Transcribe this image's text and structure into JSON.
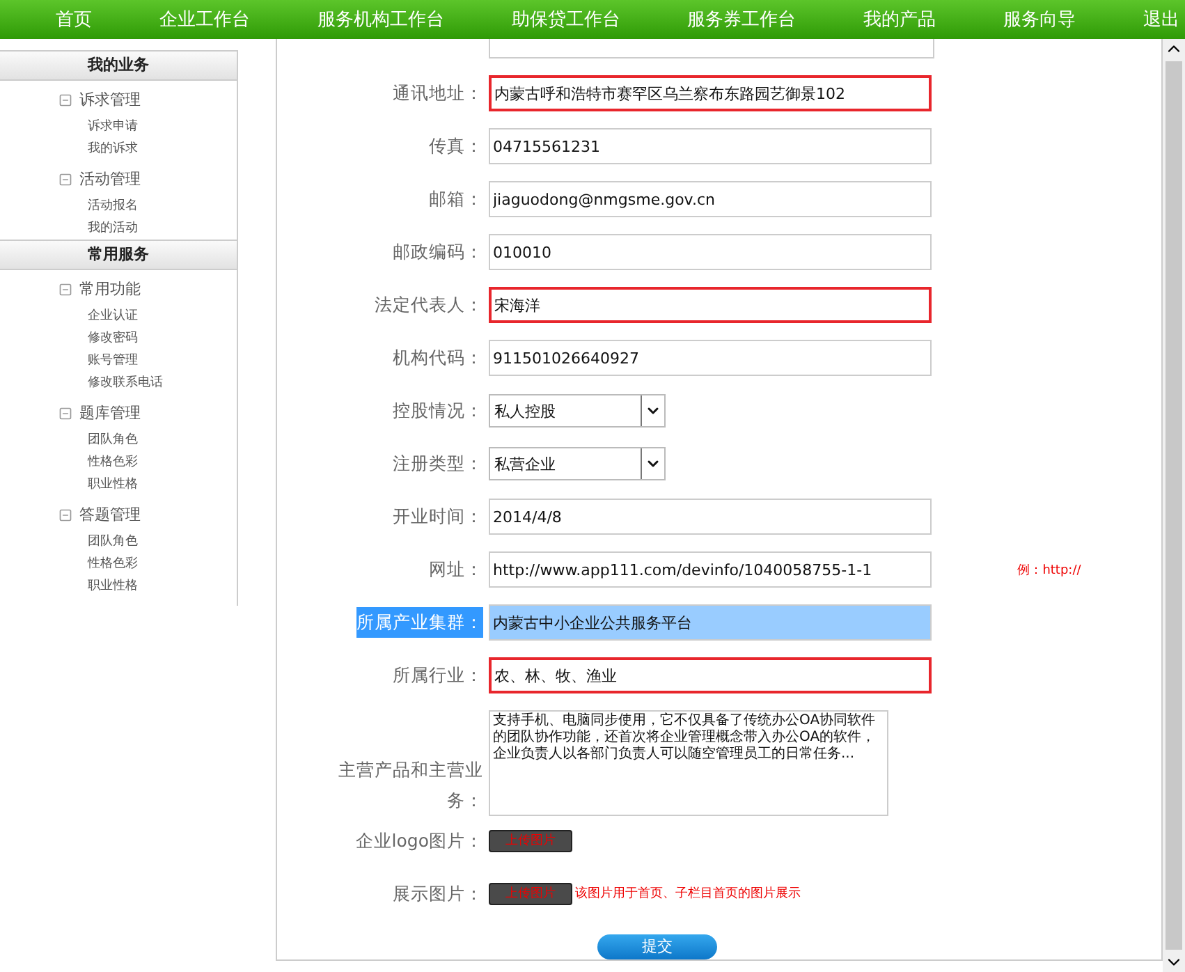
{
  "nav": {
    "items": [
      "首页",
      "企业工作台",
      "服务机构工作台",
      "助保贷工作台",
      "服务券工作台",
      "我的产品",
      "服务向导",
      "退出"
    ]
  },
  "sidebar": {
    "sections": [
      {
        "title": "我的业务",
        "groups": [
          {
            "title": "诉求管理",
            "expanded": true,
            "items": [
              "诉求申请",
              "我的诉求"
            ]
          },
          {
            "title": "活动管理",
            "expanded": true,
            "items": [
              "活动报名",
              "我的活动"
            ]
          }
        ]
      },
      {
        "title": "常用服务",
        "groups": [
          {
            "title": "常用功能",
            "expanded": true,
            "items": [
              "企业认证",
              "修改密码",
              "账号管理",
              "修改联系电话"
            ]
          },
          {
            "title": "题库管理",
            "expanded": true,
            "items": [
              "团队角色",
              "性格色彩",
              "职业性格"
            ]
          },
          {
            "title": "答题管理",
            "expanded": true,
            "items": [
              "团队角色",
              "性格色彩",
              "职业性格"
            ]
          }
        ]
      }
    ]
  },
  "form": {
    "rows": [
      {
        "kind": "text",
        "label": "通讯地址：",
        "value": "内蒙古呼和浩特市赛罕区乌兰察布东路园艺御景102",
        "highlighted": true
      },
      {
        "kind": "text",
        "label": "传真：",
        "value": "04715561231",
        "highlighted": false
      },
      {
        "kind": "text",
        "label": "邮箱：",
        "value": "jiaguodong@nmgsme.gov.cn",
        "highlighted": false
      },
      {
        "kind": "text",
        "label": "邮政编码：",
        "value": "010010",
        "highlighted": false
      },
      {
        "kind": "text",
        "label": "法定代表人：",
        "value": "宋海洋",
        "highlighted": true
      },
      {
        "kind": "text",
        "label": "机构代码：",
        "value": "911501026640927",
        "highlighted": false
      },
      {
        "kind": "select",
        "label": "控股情况：",
        "value": "私人控股"
      },
      {
        "kind": "select",
        "label": "注册类型：",
        "value": "私营企业"
      },
      {
        "kind": "text",
        "label": "开业时间：",
        "value": "2014/4/8",
        "highlighted": false
      },
      {
        "kind": "text",
        "label": "网址：",
        "value": "http://www.app111.com/devinfo/1040058755-1-1",
        "highlighted": false,
        "hint": "例：http://"
      },
      {
        "kind": "text",
        "label": "所属产业集群：",
        "value": "内蒙古中小企业公共服务平台",
        "highlighted": false,
        "text_selected": true
      },
      {
        "kind": "text",
        "label": "所属行业：",
        "value": "农、林、牧、渔业",
        "highlighted": true
      },
      {
        "kind": "textarea",
        "label": "主营产品和主营业务：",
        "value": "支持手机、电脑同步使用，它不仅具备了传统办公OA协同软件的团队协作功能，还首次将企业管理概念带入办公OA的软件，企业负责人以各部门负责人可以随空管理员工的日常任务..."
      },
      {
        "kind": "upload",
        "label": "企业logo图片：",
        "button": "上传图片"
      },
      {
        "kind": "upload",
        "label": "展示图片：",
        "button": "上传图片",
        "hint": "该图片用于首页、子栏目首页的图片展示"
      }
    ]
  },
  "submit": "提交"
}
